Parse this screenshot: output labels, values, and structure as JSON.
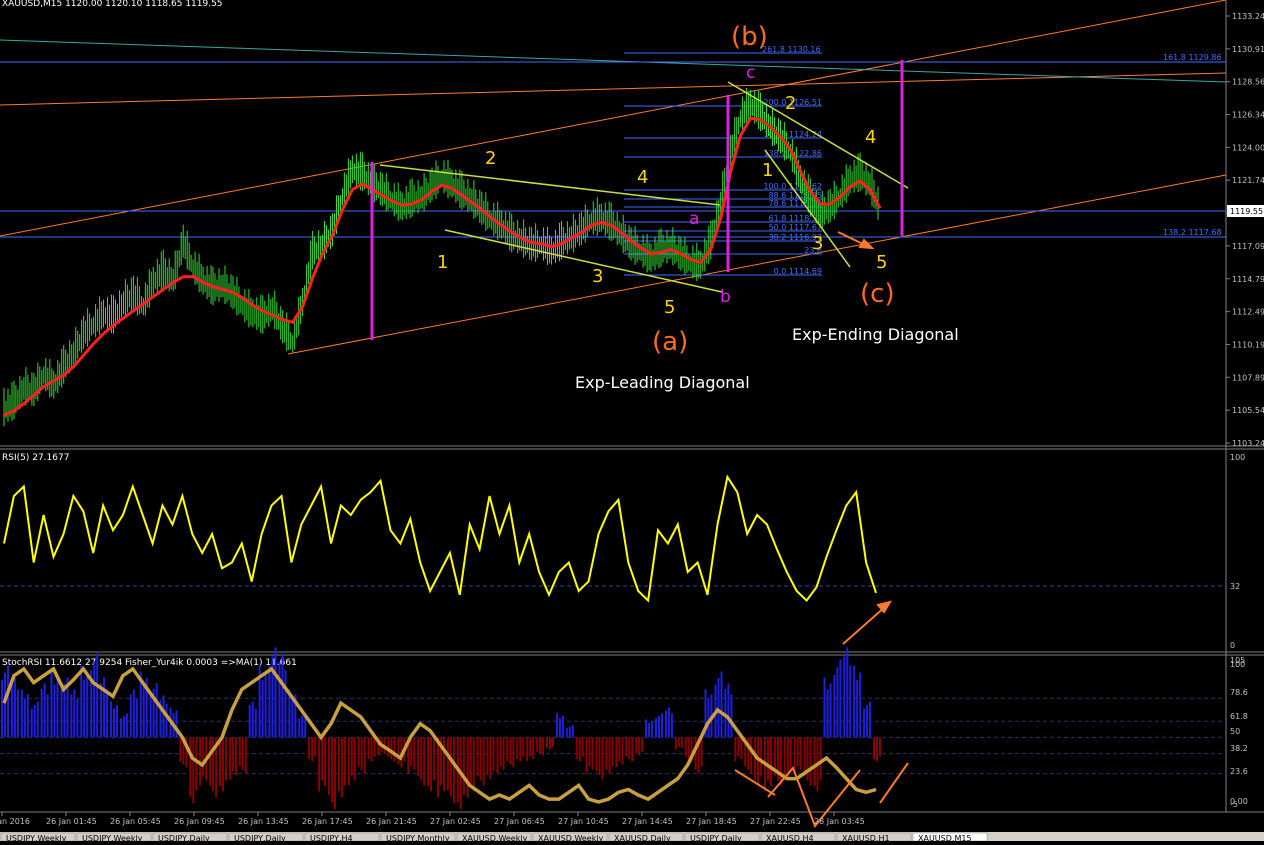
{
  "colors": {
    "background": "#000000",
    "grid": "#2a2a2a",
    "price": "#33dd33",
    "ma": "#ff2020",
    "trend": "#ff7a2a",
    "fib": "#3f6cff",
    "cyan": "#3aa7a7",
    "diagonal": "#c8e040",
    "magenta": "#e020e0",
    "wave_yellow": "#ffd400",
    "wave_orange": "#ff6a1f",
    "rsi": "#ffff00",
    "hist_pos": "#1f1fe0",
    "hist_neg": "#8a0000",
    "stoch": "#c8a040",
    "text": "#ffffff",
    "axis_text": "#c0c0c0"
  },
  "header": {
    "symbol_line": "XAUUSD,M15  1120.00 1120.10 1118.65 1119.55"
  },
  "price_axis": {
    "ticks": [
      "1133.24",
      "1130.91",
      "1128.56",
      "1126.34",
      "1124.00",
      "1121.74",
      "1119.55",
      "1117.09",
      "1114.79",
      "1112.49",
      "1110.19",
      "1107.89",
      "1105.54",
      "1103.24"
    ],
    "current": "1119.55"
  },
  "time_axis": {
    "labels": [
      "25 Jan 2016",
      "26 Jan 01:45",
      "26 Jan 05:45",
      "26 Jan 09:45",
      "26 Jan 13:45",
      "26 Jan 17:45",
      "26 Jan 21:45",
      "27 Jan 02:45",
      "27 Jan 06:45",
      "27 Jan 10:45",
      "27 Jan 14:45",
      "27 Jan 18:45",
      "27 Jan 22:45",
      "28 Jan 03:45"
    ]
  },
  "fib_levels": [
    {
      "label": "261.8 1130.16"
    },
    {
      "label": "200.0 1126.51"
    },
    {
      "label": "161.8 1124.24"
    },
    {
      "label": "138.2 1122.86"
    },
    {
      "label": "100.0 1120.62"
    },
    {
      "label": "88.6 1119.95"
    },
    {
      "label": "78.6 1119.36"
    },
    {
      "label": "61.8 1118.37"
    },
    {
      "label": "50.0 1117.67"
    },
    {
      "label": "38.2 1116.97"
    },
    {
      "label": "23.6"
    },
    {
      "label": "0.0 1114.69"
    }
  ],
  "fib_right": {
    "top": "161.8 1129.86",
    "bottom": "138.2 1117.68"
  },
  "wave_labels": {
    "big_b": "(b)",
    "big_a": "(a)",
    "big_c": "(c)",
    "small_a": "a",
    "small_b": "b",
    "small_c": "c",
    "one_l": "1",
    "two_l": "2",
    "three_l": "3",
    "four_l": "4",
    "five_l": "5",
    "one_r": "1",
    "two_r": "2",
    "three_r": "3",
    "four_r": "4",
    "five_r": "5"
  },
  "annotations": {
    "leading": "Exp-Leading Diagonal",
    "ending": "Exp-Ending Diagonal"
  },
  "rsi_panel": {
    "title": "RSI(5) 27.1677",
    "ticks": [
      "100",
      "32",
      "0"
    ]
  },
  "stoch_panel": {
    "title": "StochRSI 11.6612 27.9254  Fisher_Yur4ik 0.0003  =>MA(1) 11.661",
    "ticks": [
      "105",
      "100",
      "78.6",
      "61.8",
      "50",
      "38.2",
      "23.6",
      "0.00",
      "-5"
    ]
  },
  "bottom_tabs": [
    "USDJPY,Weekly",
    "USDJPY,Weekly",
    "USDJPY,Daily",
    "USDJPY,Daily",
    "USDJPY,H4",
    "USDJPY,Monthly",
    "XAUUSD,Weekly",
    "XAUUSD,Weekly",
    "XAUUSD,Daily",
    "USDJPY,Daily",
    "XAUUSD,H4",
    "XAUUSD,H1",
    "XAUUSD,M15"
  ],
  "chart_data": {
    "type": "line",
    "title": "XAUUSD,M15",
    "ylim": [
      1103.24,
      1134.5
    ],
    "close": [
      1105.5,
      1106.0,
      1107.0,
      1106.8,
      1108.0,
      1107.2,
      1108.5,
      1109.5,
      1110.8,
      1111.5,
      1112.2,
      1112.0,
      1113.0,
      1113.6,
      1112.8,
      1114.5,
      1115.2,
      1114.6,
      1117.2,
      1115.5,
      1114.5,
      1114.0,
      1114.2,
      1113.6,
      1112.8,
      1112.2,
      1112.0,
      1112.6,
      1111.2,
      1110.2,
      1113.0,
      1116.5,
      1117.0,
      1118.0,
      1120.5,
      1122.3,
      1122.0,
      1121.3,
      1120.8,
      1120.2,
      1119.7,
      1120.2,
      1120.4,
      1121.2,
      1121.8,
      1121.3,
      1120.7,
      1120.2,
      1119.5,
      1118.8,
      1118.4,
      1117.7,
      1117.4,
      1117.0,
      1117.1,
      1116.6,
      1117.2,
      1117.6,
      1118.1,
      1118.8,
      1118.9,
      1118.5,
      1117.8,
      1117.0,
      1116.6,
      1116.1,
      1116.7,
      1116.9,
      1116.3,
      1115.8,
      1115.6,
      1117.2,
      1120.0,
      1123.5,
      1126.0,
      1126.9,
      1126.2,
      1125.3,
      1124.5,
      1123.6,
      1121.6,
      1120.2,
      1119.2,
      1119.7,
      1120.5,
      1121.6,
      1122.0,
      1121.3,
      1119.5
    ],
    "ma": [
      1105.2,
      1105.5,
      1106.0,
      1106.6,
      1107.2,
      1107.6,
      1108.0,
      1108.6,
      1109.4,
      1110.2,
      1110.9,
      1111.5,
      1112.0,
      1112.5,
      1113.0,
      1113.5,
      1114.0,
      1114.5,
      1114.9,
      1114.9,
      1114.5,
      1114.2,
      1114.0,
      1113.8,
      1113.4,
      1112.9,
      1112.5,
      1112.2,
      1111.9,
      1111.7,
      1112.8,
      1114.8,
      1116.5,
      1117.8,
      1119.6,
      1121.0,
      1121.4,
      1121.0,
      1120.6,
      1120.2,
      1119.9,
      1120.0,
      1120.3,
      1120.9,
      1121.3,
      1121.1,
      1120.6,
      1120.1,
      1119.6,
      1119.0,
      1118.5,
      1118.0,
      1117.6,
      1117.3,
      1117.2,
      1117.0,
      1117.2,
      1117.6,
      1118.0,
      1118.5,
      1118.7,
      1118.5,
      1118.0,
      1117.4,
      1116.9,
      1116.5,
      1116.6,
      1116.8,
      1116.5,
      1116.1,
      1115.9,
      1116.8,
      1119.0,
      1122.3,
      1124.8,
      1126.0,
      1125.9,
      1125.4,
      1124.7,
      1123.8,
      1122.3,
      1120.9,
      1120.0,
      1120.0,
      1120.5,
      1121.2,
      1121.6,
      1121.0,
      1119.7
    ],
    "rsi": [
      55,
      80,
      85,
      45,
      70,
      48,
      60,
      80,
      72,
      50,
      75,
      62,
      70,
      85,
      70,
      55,
      75,
      65,
      80,
      60,
      50,
      60,
      42,
      45,
      55,
      35,
      60,
      75,
      80,
      45,
      65,
      75,
      85,
      55,
      75,
      70,
      78,
      82,
      88,
      62,
      55,
      68,
      45,
      30,
      40,
      50,
      28,
      65,
      52,
      80,
      60,
      75,
      45,
      60,
      40,
      28,
      40,
      45,
      30,
      35,
      60,
      72,
      78,
      45,
      30,
      25,
      62,
      55,
      65,
      40,
      45,
      28,
      65,
      90,
      82,
      60,
      70,
      65,
      52,
      40,
      30,
      25,
      32,
      48,
      62,
      75,
      82,
      45,
      29
    ],
    "stoch_line": [
      75,
      95,
      100,
      90,
      95,
      100,
      85,
      92,
      100,
      90,
      85,
      80,
      95,
      100,
      90,
      80,
      70,
      60,
      50,
      35,
      30,
      40,
      50,
      70,
      85,
      90,
      95,
      100,
      90,
      80,
      70,
      60,
      50,
      60,
      75,
      70,
      65,
      55,
      45,
      40,
      35,
      50,
      60,
      55,
      45,
      35,
      25,
      15,
      10,
      5,
      8,
      5,
      10,
      15,
      8,
      5,
      5,
      10,
      15,
      5,
      3,
      5,
      10,
      12,
      8,
      5,
      10,
      15,
      20,
      30,
      45,
      60,
      70,
      65,
      55,
      45,
      35,
      30,
      25,
      20,
      20,
      25,
      30,
      35,
      28,
      20,
      12,
      10,
      12
    ],
    "stoch_hist": [
      60,
      50,
      40,
      30,
      45,
      55,
      50,
      40,
      60,
      70,
      50,
      30,
      20,
      40,
      55,
      45,
      35,
      25,
      -25,
      -55,
      -40,
      -50,
      -45,
      -35,
      -30,
      30,
      60,
      75,
      70,
      40,
      20,
      -20,
      -45,
      -60,
      -50,
      -40,
      -30,
      -20,
      -15,
      -20,
      -25,
      -30,
      -40,
      -45,
      -50,
      -55,
      -60,
      -50,
      -40,
      -35,
      -30,
      -25,
      -20,
      -20,
      -15,
      -10,
      20,
      10,
      -20,
      -30,
      -35,
      -30,
      -25,
      -20,
      -15,
      15,
      20,
      25,
      -10,
      -20,
      -30,
      40,
      55,
      45,
      -20,
      -30,
      -40,
      -45,
      -40,
      -35,
      -30,
      -40,
      -45,
      50,
      65,
      75,
      60,
      30,
      -20
    ],
    "legend": [
      "XAUUSD,M15"
    ]
  }
}
